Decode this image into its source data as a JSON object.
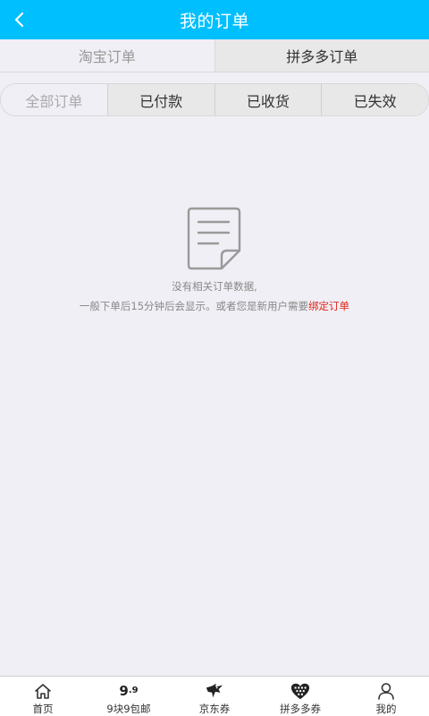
{
  "header": {
    "title": "我的订单"
  },
  "platform_tabs": [
    {
      "label": "淘宝订单",
      "active": false
    },
    {
      "label": "拼多多订单",
      "active": true
    }
  ],
  "status_tabs": [
    {
      "label": "全部订单"
    },
    {
      "label": "已付款"
    },
    {
      "label": "已收货"
    },
    {
      "label": "已失效"
    }
  ],
  "empty": {
    "line1": "没有相关订单数据,",
    "line2_prefix": "一般下单后15分钟后会显示。或者您是新用户需要",
    "bind_link": "绑定订单"
  },
  "tabbar": {
    "items": [
      {
        "label": "首页",
        "icon": "home-icon"
      },
      {
        "label": "9块9包邮",
        "icon": "nine-nine-icon",
        "glyph_main": "9",
        "glyph_small": ".9"
      },
      {
        "label": "京东券",
        "icon": "jd-dog-icon"
      },
      {
        "label": "拼多多券",
        "icon": "pdd-heart-icon"
      },
      {
        "label": "我的",
        "icon": "user-icon"
      }
    ]
  },
  "colors": {
    "header_bg": "#00bfff",
    "page_bg": "#f0eff5",
    "link_red": "#e2231a"
  }
}
